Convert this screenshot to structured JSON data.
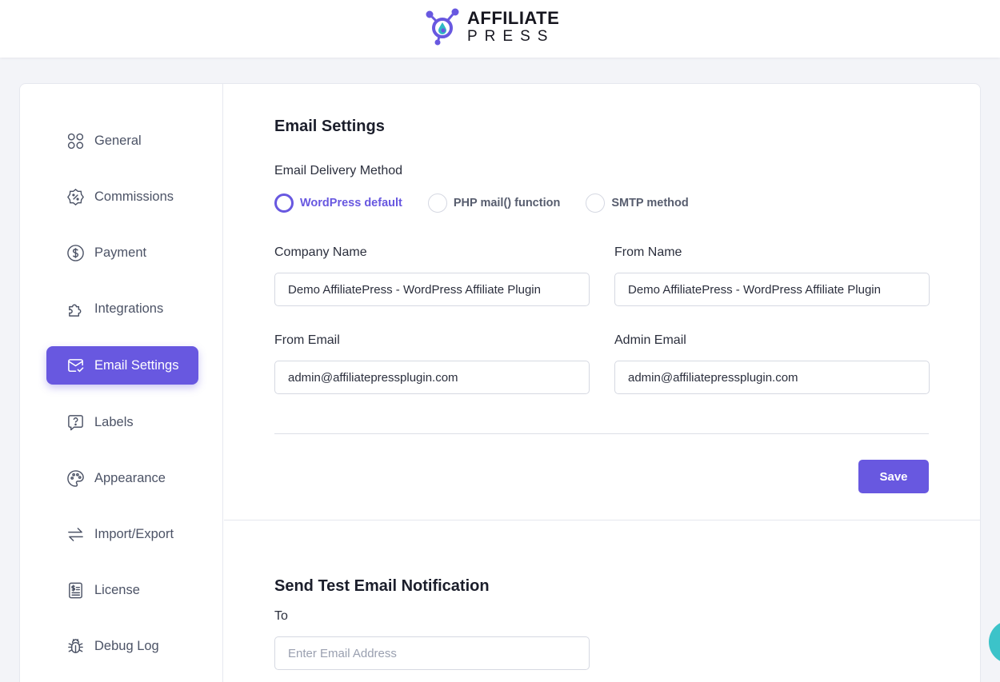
{
  "brand": {
    "line1": "AFFILIATE",
    "line2": "PRESS",
    "colors": {
      "purple": "#6858e0",
      "teal": "#2fb9c4"
    }
  },
  "sidebar": {
    "items": [
      {
        "label": "General",
        "icon": "grid-icon"
      },
      {
        "label": "Commissions",
        "icon": "percent-badge-icon"
      },
      {
        "label": "Payment",
        "icon": "dollar-circle-icon"
      },
      {
        "label": "Integrations",
        "icon": "puzzle-icon"
      },
      {
        "label": "Email Settings",
        "icon": "mail-check-icon",
        "active": true
      },
      {
        "label": "Labels",
        "icon": "question-bubble-icon"
      },
      {
        "label": "Appearance",
        "icon": "palette-icon"
      },
      {
        "label": "Import/Export",
        "icon": "arrows-swap-icon"
      },
      {
        "label": "License",
        "icon": "receipt-icon"
      },
      {
        "label": "Debug Log",
        "icon": "bug-icon"
      }
    ]
  },
  "email_settings": {
    "title": "Email Settings",
    "delivery_label": "Email Delivery Method",
    "delivery_options": [
      {
        "label": "WordPress default",
        "selected": true
      },
      {
        "label": "PHP mail() function",
        "selected": false
      },
      {
        "label": "SMTP method",
        "selected": false
      }
    ],
    "company_name_label": "Company Name",
    "company_name_value": "Demo AffiliatePress - WordPress Affiliate Plugin",
    "from_name_label": "From Name",
    "from_name_value": "Demo AffiliatePress - WordPress Affiliate Plugin",
    "from_email_label": "From Email",
    "from_email_value": "admin@affiliatepressplugin.com",
    "admin_email_label": "Admin Email",
    "admin_email_value": "admin@affiliatepressplugin.com",
    "save_label": "Save"
  },
  "test_email": {
    "title": "Send Test Email Notification",
    "to_label": "To",
    "to_placeholder": "Enter Email Address"
  }
}
